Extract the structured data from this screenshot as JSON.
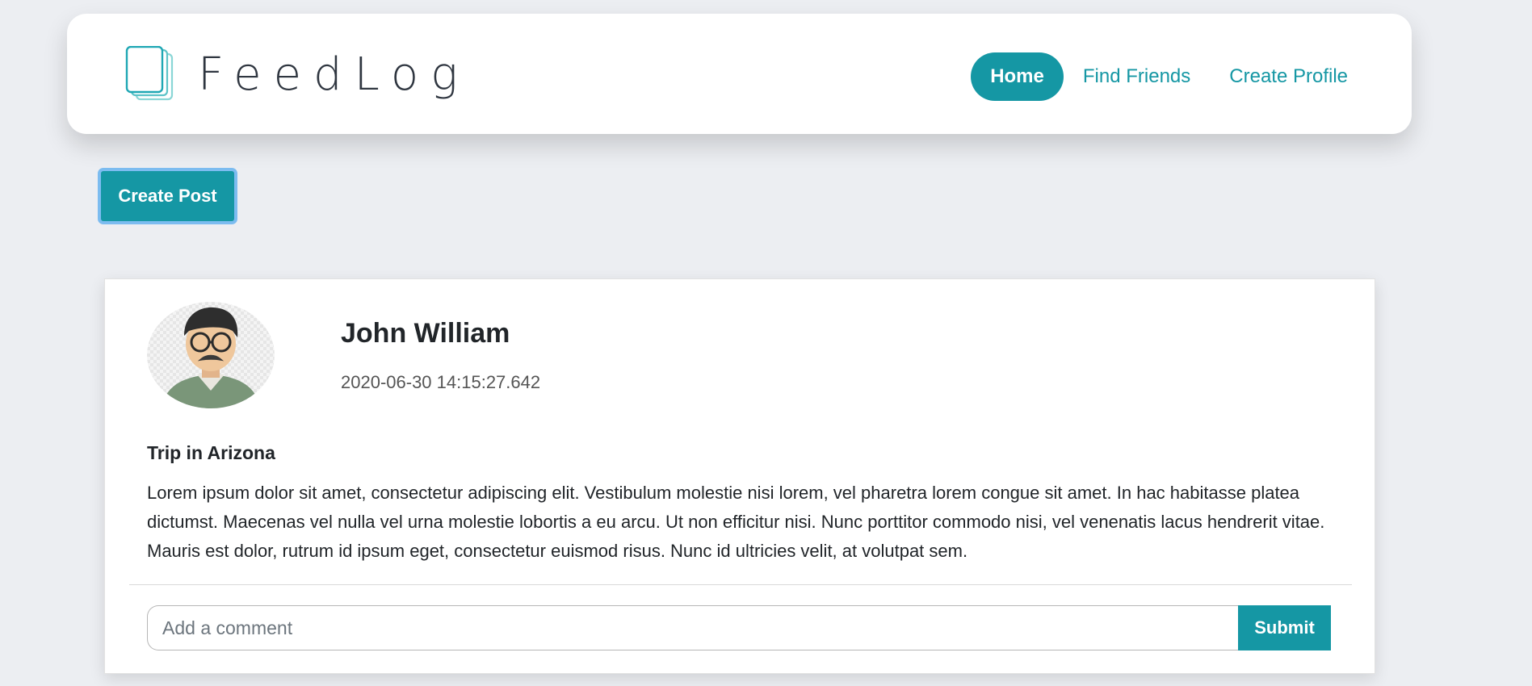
{
  "brand": {
    "name": "FeedLog",
    "icon": "stacked-pages-icon"
  },
  "nav": {
    "items": [
      {
        "label": "Home",
        "active": true
      },
      {
        "label": "Find Friends",
        "active": false
      },
      {
        "label": "Create Profile",
        "active": false
      }
    ]
  },
  "actions": {
    "create_post_label": "Create Post"
  },
  "post": {
    "author": "John William",
    "timestamp": "2020-06-30 14:15:27.642",
    "title": "Trip in Arizona",
    "body": "Lorem ipsum dolor sit amet, consectetur adipiscing elit. Vestibulum molestie nisi lorem, vel pharetra lorem congue sit amet. In hac habitasse platea dictumst. Maecenas vel nulla vel urna molestie lobortis a eu arcu. Ut non efficitur nisi. Nunc porttitor commodo nisi, vel venenatis lacus hendrerit vitae. Mauris est dolor, rutrum id ipsum eget, consectetur euismod risus. Nunc id ultricies velit, at volutpat sem.",
    "avatar_icon": "man-with-glasses-avatar"
  },
  "comment": {
    "placeholder": "Add a comment",
    "value": "",
    "submit_label": "Submit"
  },
  "colors": {
    "accent": "#1597a4",
    "background": "#eceef2",
    "focus_ring": "#7cbcf0"
  }
}
